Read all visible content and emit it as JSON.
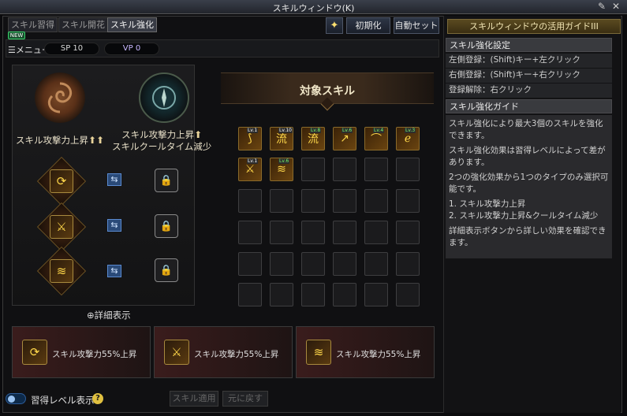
{
  "window": {
    "title": "スキルウィンドウ(K)"
  },
  "tabs": [
    {
      "label": "スキル習得",
      "active": false
    },
    {
      "label": "スキル開花",
      "active": false
    },
    {
      "label": "スキル強化",
      "active": true
    }
  ],
  "new_badge": "NEW",
  "header_buttons": {
    "reset": "初期化",
    "auto_set": "自動セット"
  },
  "menu": {
    "label": "メニュー",
    "sp": "SP 10",
    "vp": "VP 0"
  },
  "enhance_types": [
    {
      "label": "スキル攻撃力上昇",
      "icon": "spiral-emblem-icon"
    },
    {
      "label_line1": "スキル攻撃力上昇",
      "label_line2": "スキルクールタイム減少",
      "icon": "compass-emblem-icon"
    }
  ],
  "target_skills_title": "対象スキル",
  "skill_slots_row1": [
    {
      "level": "Lv.1",
      "level_green": false
    },
    {
      "level": "Lv.10",
      "level_green": false
    },
    {
      "level": "Lv.8",
      "level_green": true
    },
    {
      "level": "Lv.6",
      "level_green": true
    },
    {
      "level": "Lv.4",
      "level_green": true
    },
    {
      "level": "Lv.3",
      "level_green": true
    }
  ],
  "skill_slots_row2": [
    {
      "level": "Lv.1",
      "level_green": false
    },
    {
      "level": "Lv.6",
      "level_green": true
    }
  ],
  "detail_link": "詳細表示",
  "effect_cards": [
    {
      "text": "スキル攻撃力55%上昇"
    },
    {
      "text": "スキル攻撃力55%上昇"
    },
    {
      "text": "スキル攻撃力55%上昇"
    }
  ],
  "footer": {
    "toggle_label": "習得レベル表示",
    "apply": "スキル適用",
    "revert": "元に戻す"
  },
  "guide": {
    "title": "スキルウィンドウの活用ガイドIII",
    "settings_header": "スキル強化設定",
    "settings_rows": [
      "左側登録：(Shift)キー+左クリック",
      "右側登録：(Shift)キー+右クリック",
      "登録解除：右クリック"
    ],
    "guide_header": "スキル強化ガイド",
    "guide_lines": [
      "スキル強化により最大3個のスキルを強化できます。",
      "スキル強化効果は習得レベルによって差があります。",
      "2つの強化効果から1つのタイプのみ選択可能です。",
      "1. スキル攻撃力上昇",
      "2. スキル攻撃力上昇&クールタイム減少",
      "詳細表示ボタンから詳しい効果を確認できます。"
    ]
  },
  "colors": {
    "accent_gold": "#e8d39a",
    "level_green": "#7aff6a",
    "swap_blue": "#2a4a78"
  }
}
